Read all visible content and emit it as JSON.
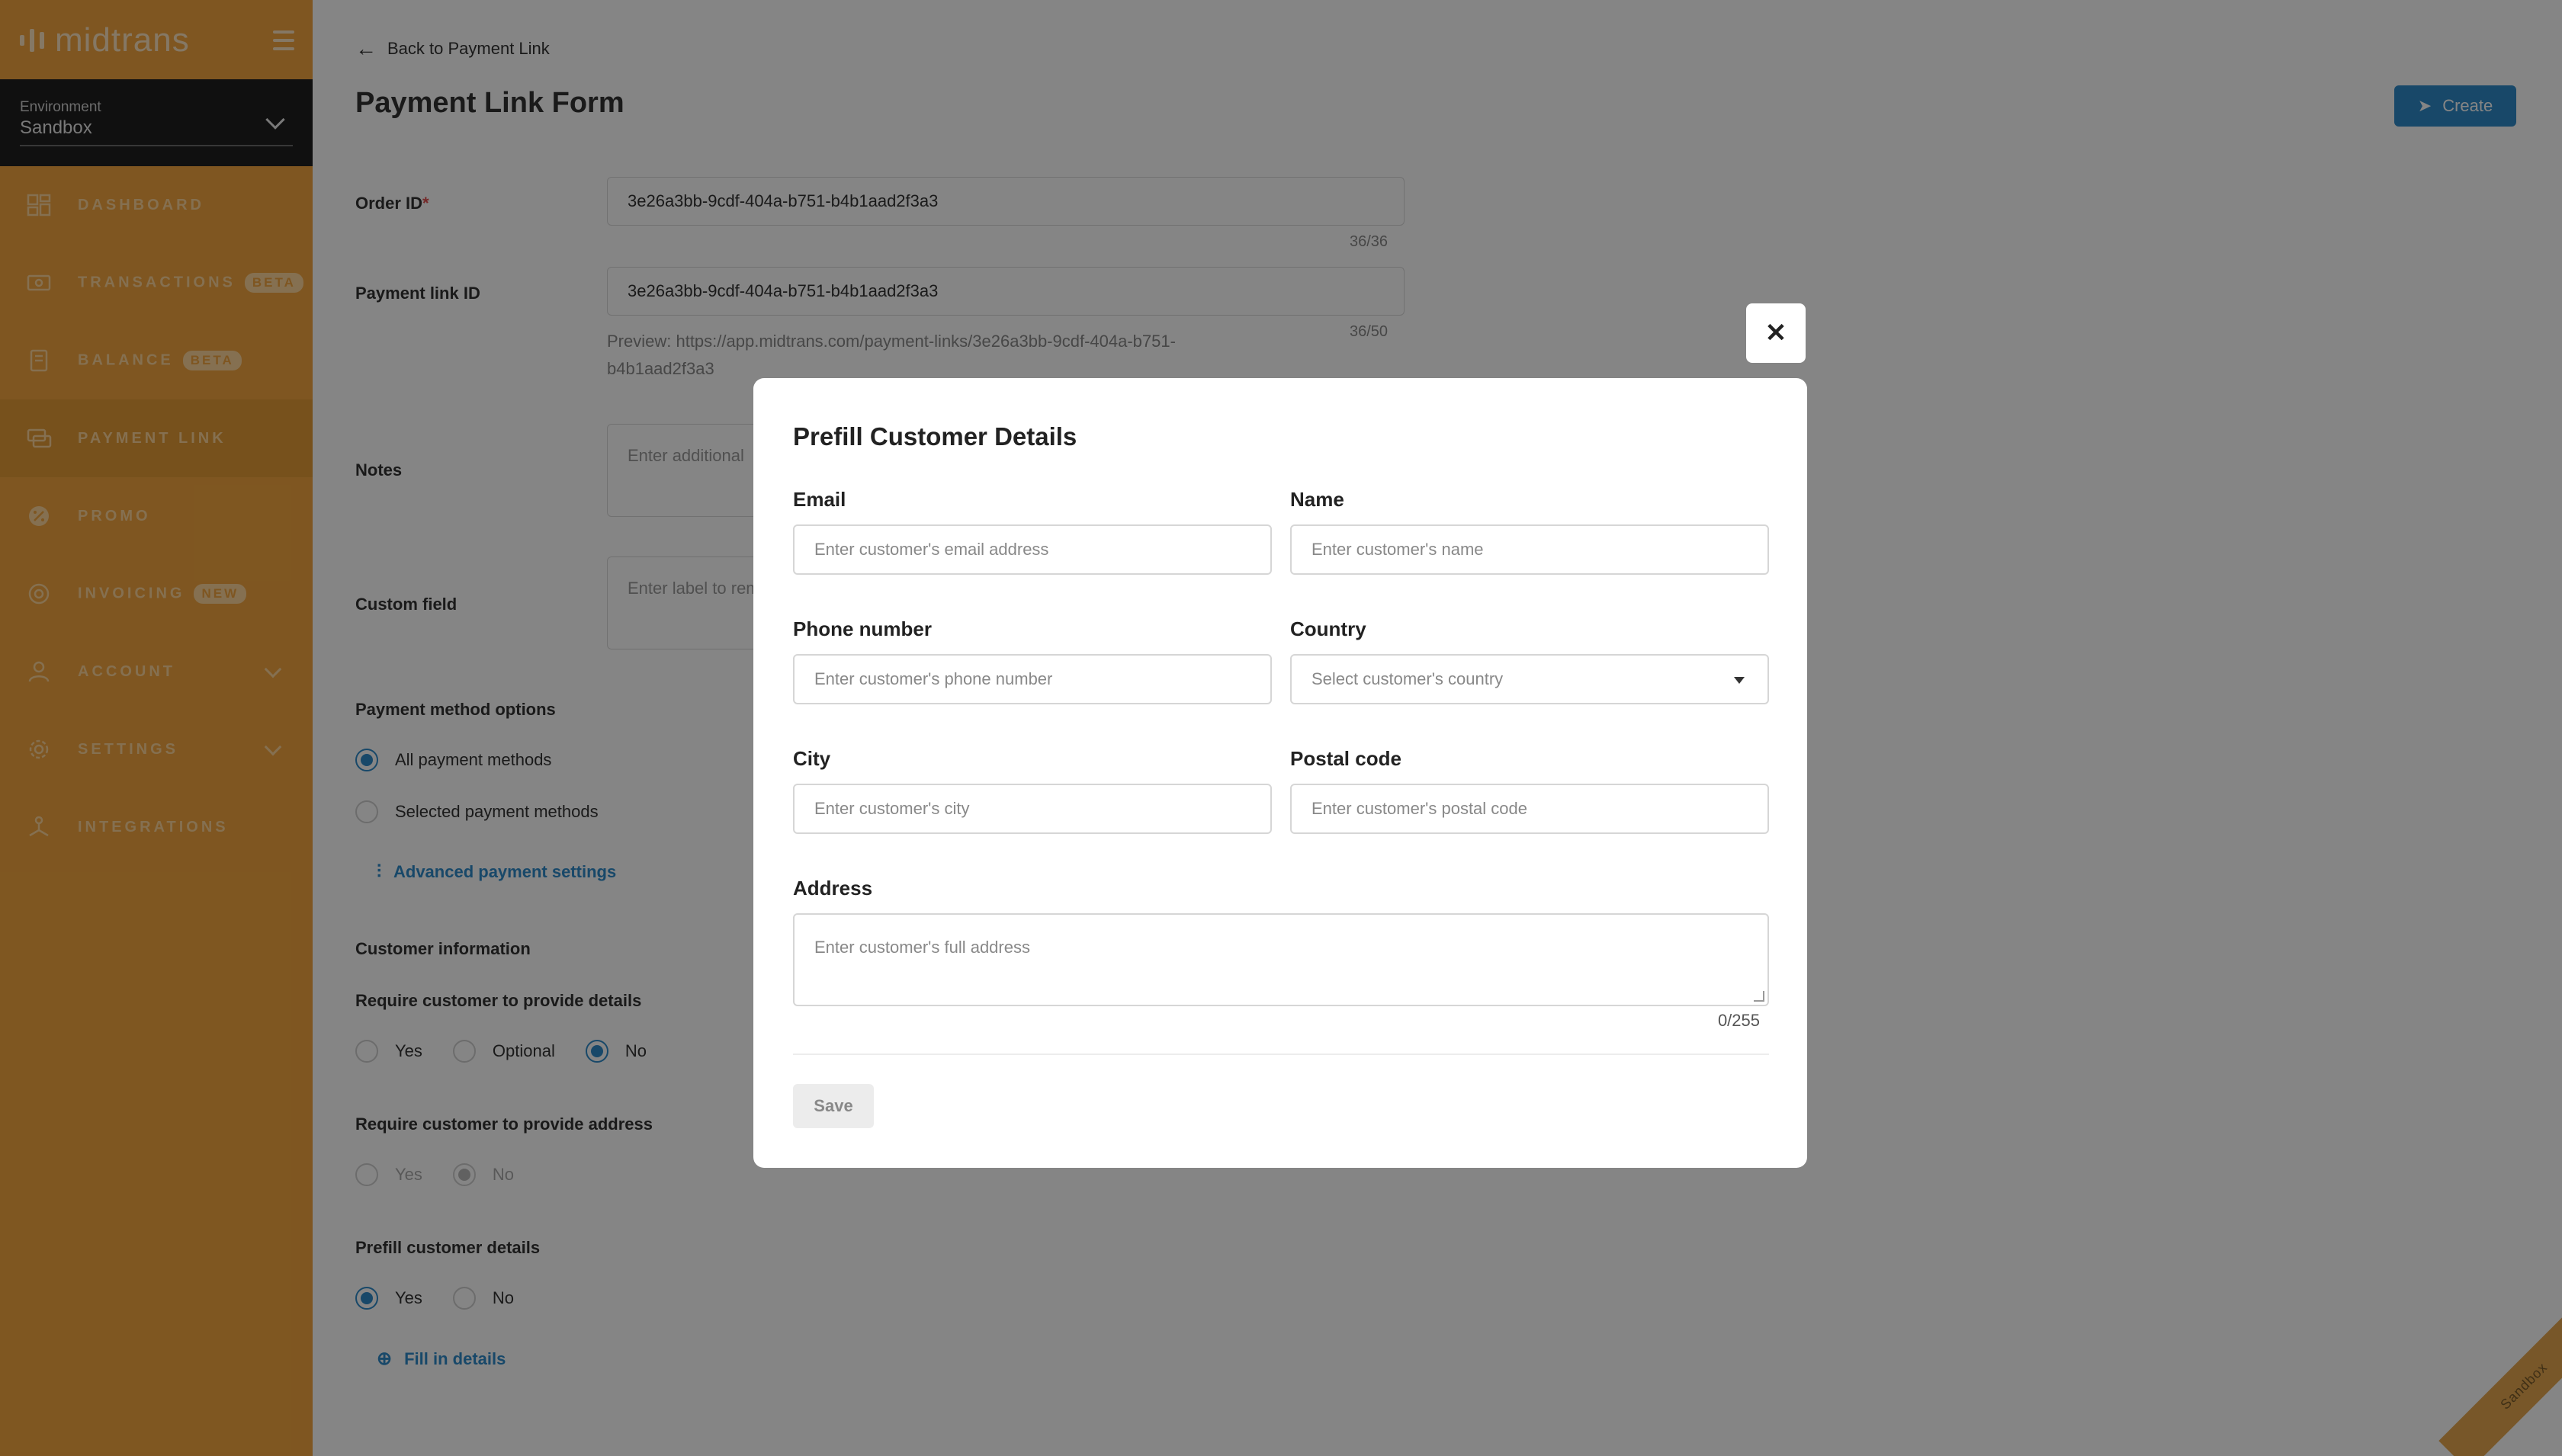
{
  "sidebar": {
    "logo_text": "midtrans",
    "environment": {
      "label": "Environment",
      "value": "Sandbox"
    },
    "items": [
      {
        "label": "DASHBOARD",
        "icon": "dashboard-icon"
      },
      {
        "label": "TRANSACTIONS",
        "badge": "BETA",
        "icon": "transactions-icon"
      },
      {
        "label": "BALANCE",
        "badge": "BETA",
        "icon": "balance-icon"
      },
      {
        "label": "PAYMENT LINK",
        "icon": "payment-link-icon",
        "active": true
      },
      {
        "label": "PROMO",
        "icon": "promo-icon"
      },
      {
        "label": "INVOICING",
        "badge": "NEW",
        "icon": "invoicing-icon"
      },
      {
        "label": "ACCOUNT",
        "icon": "account-icon",
        "expandable": true
      },
      {
        "label": "SETTINGS",
        "icon": "settings-icon",
        "expandable": true
      },
      {
        "label": "INTEGRATIONS",
        "icon": "integrations-icon"
      }
    ]
  },
  "header": {
    "back_label": "Back to Payment Link",
    "title": "Payment Link Form",
    "create_label": "Create"
  },
  "form": {
    "order_id": {
      "label": "Order ID",
      "required_mark": "*",
      "value": "3e26a3bb-9cdf-404a-b751-b4b1aad2f3a3",
      "counter": "36/36"
    },
    "payment_link_id": {
      "label": "Payment link ID",
      "value": "3e26a3bb-9cdf-404a-b751-b4b1aad2f3a3",
      "counter": "36/50",
      "preview_line1": "Preview: https://app.midtrans.com/payment-links/3e26a3bb-9cdf-404a-b751-",
      "preview_line2": "b4b1aad2f3a3"
    },
    "notes": {
      "label": "Notes",
      "placeholder": "Enter additional"
    },
    "custom_field": {
      "label": "Custom field",
      "placeholder": "Enter label to rem"
    },
    "payment_method_options": {
      "label": "Payment method options",
      "option_all": "All payment methods",
      "option_selected": "Selected payment methods",
      "advanced_link": "Advanced payment settings"
    },
    "customer_information": {
      "label": "Customer information"
    },
    "require_details": {
      "label": "Require customer to provide details",
      "yes": "Yes",
      "optional": "Optional",
      "no": "No"
    },
    "require_address": {
      "label": "Require customer to provide address",
      "yes": "Yes",
      "no": "No"
    },
    "prefill_details": {
      "label": "Prefill customer details",
      "yes": "Yes",
      "no": "No",
      "fill_link": "Fill in details"
    }
  },
  "modal": {
    "title": "Prefill Customer Details",
    "close_symbol": "✕",
    "email": {
      "label": "Email",
      "placeholder": "Enter customer's email address"
    },
    "name": {
      "label": "Name",
      "placeholder": "Enter customer's name"
    },
    "phone": {
      "label": "Phone number",
      "placeholder": "Enter customer's phone number"
    },
    "country": {
      "label": "Country",
      "placeholder": "Select customer's country"
    },
    "city": {
      "label": "City",
      "placeholder": "Enter customer's city"
    },
    "postal_code": {
      "label": "Postal code",
      "placeholder": "Enter customer's postal code"
    },
    "address": {
      "label": "Address",
      "placeholder": "Enter customer's full address",
      "counter": "0/255"
    },
    "save_label": "Save"
  },
  "corner_label": "Sandbox",
  "colors": {
    "sidebar": "#f4a640",
    "accent": "#2e8bc9",
    "overlay": "rgba(0,0,0,0.48)"
  }
}
